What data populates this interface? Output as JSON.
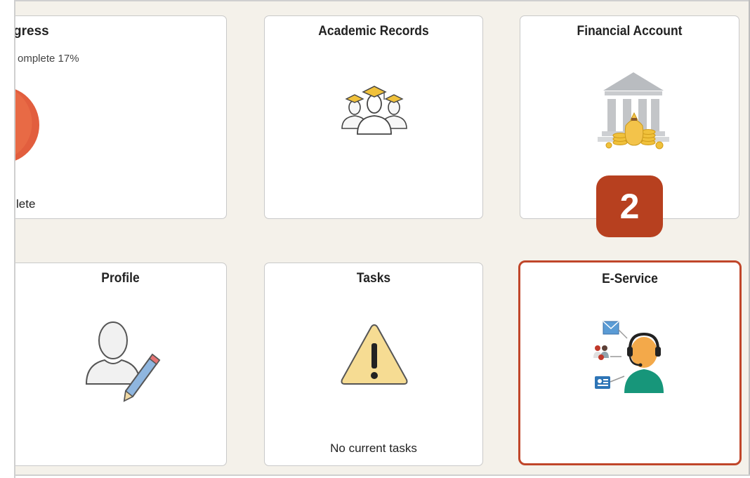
{
  "tiles": {
    "progress": {
      "title": "gress",
      "subtitle": "omplete 17%",
      "footer": "lete"
    },
    "academic": {
      "title": "Academic Records"
    },
    "financial": {
      "title": "Financial Account"
    },
    "profile": {
      "title": "Profile"
    },
    "tasks": {
      "title": "Tasks",
      "footer": "No current tasks"
    },
    "eservice": {
      "title": "E-Service"
    }
  },
  "badge": {
    "label": "2"
  },
  "colors": {
    "accent": "#c0462a",
    "badge": "#b7401f",
    "person_teal": "#17967a",
    "gold": "#f0c13b"
  },
  "icons": [
    "graduates-icon",
    "bank-coins-icon",
    "profile-edit-icon",
    "warning-icon",
    "support-agent-icon"
  ]
}
